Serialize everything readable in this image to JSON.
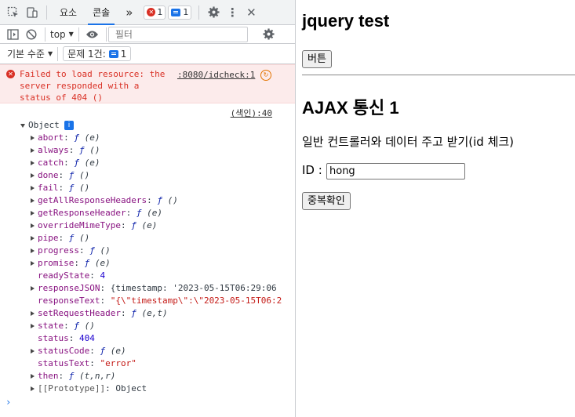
{
  "devtools": {
    "tabs": [
      {
        "label": "요소"
      },
      {
        "label": "콘솔"
      }
    ],
    "more_tabs": "»",
    "error_count": "1",
    "message_count": "1",
    "context": "top",
    "filter_placeholder": "필터",
    "levels_label": "기본 수준",
    "issues_label": "문제 1건:",
    "issues_count": "1",
    "error_message": "Failed to load resource: the server responded with a status of 404 ()",
    "error_source": ":8080/idcheck:1",
    "log_source": "(색인):40",
    "object_label": "Object",
    "properties": [
      {
        "key": "abort",
        "value": "ƒ (e)",
        "expandable": true
      },
      {
        "key": "always",
        "value": "ƒ ()",
        "expandable": true
      },
      {
        "key": "catch",
        "value": "ƒ (e)",
        "expandable": true
      },
      {
        "key": "done",
        "value": "ƒ ()",
        "expandable": true
      },
      {
        "key": "fail",
        "value": "ƒ ()",
        "expandable": true
      },
      {
        "key": "getAllResponseHeaders",
        "value": "ƒ ()",
        "expandable": true
      },
      {
        "key": "getResponseHeader",
        "value": "ƒ (e)",
        "expandable": true
      },
      {
        "key": "overrideMimeType",
        "value": "ƒ (e)",
        "expandable": true
      },
      {
        "key": "pipe",
        "value": "ƒ ()",
        "expandable": true
      },
      {
        "key": "progress",
        "value": "ƒ ()",
        "expandable": true
      },
      {
        "key": "promise",
        "value": "ƒ (e)",
        "expandable": true
      },
      {
        "key": "readyState",
        "value": "4",
        "expandable": false
      },
      {
        "key": "responseJSON",
        "value": "{timestamp: '2023-05-15T06:29:06",
        "expandable": true
      },
      {
        "key": "responseText",
        "value": "\"{\\\"timestamp\\\":\\\"2023-05-15T06:2",
        "expandable": false
      },
      {
        "key": "setRequestHeader",
        "value": "ƒ (e,t)",
        "expandable": true
      },
      {
        "key": "state",
        "value": "ƒ ()",
        "expandable": true
      },
      {
        "key": "status",
        "value": "404",
        "expandable": false
      },
      {
        "key": "statusCode",
        "value": "ƒ (e)",
        "expandable": true
      },
      {
        "key": "statusText",
        "value": "\"error\"",
        "expandable": false
      },
      {
        "key": "then",
        "value": "ƒ (t,n,r)",
        "expandable": true
      },
      {
        "key": "[[Prototype]]",
        "value": "Object",
        "expandable": true
      }
    ],
    "prompt": "›"
  },
  "page": {
    "title": "jquery test",
    "button1_label": "버튼",
    "section_title": "AJAX 통신 1",
    "description": "일반 컨트롤러와 데이터 주고 받기(id 체크)",
    "id_label": "ID :",
    "id_value": "hong",
    "check_button_label": "중복확인"
  }
}
